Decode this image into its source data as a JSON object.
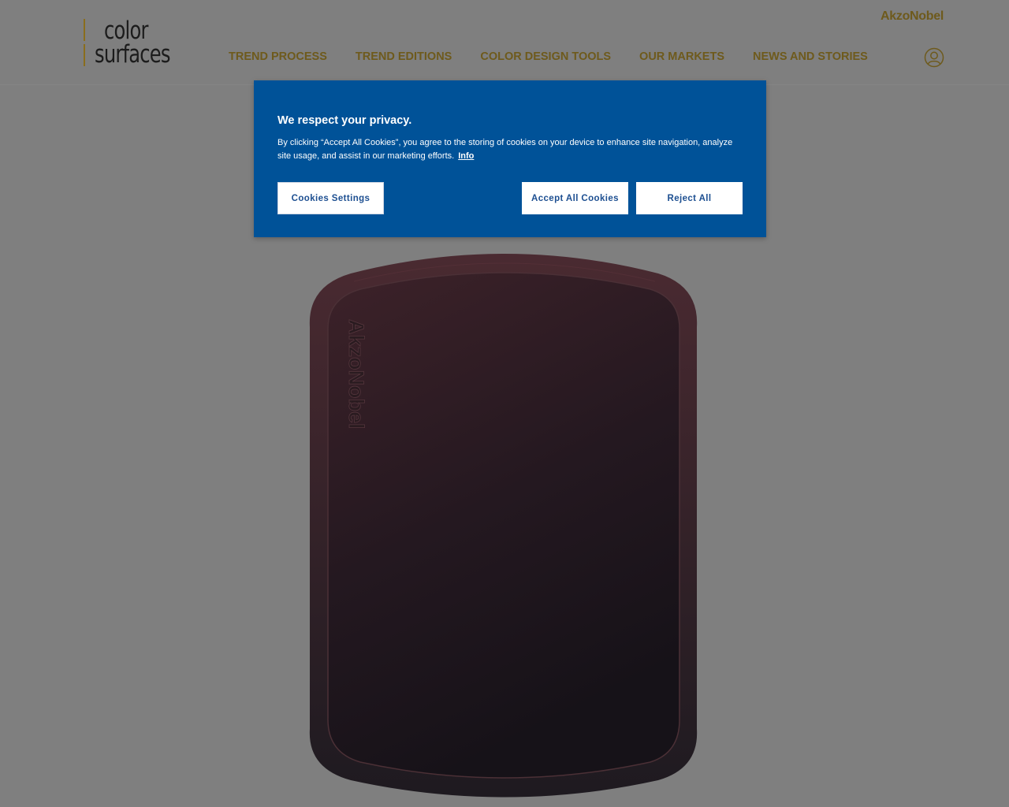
{
  "header": {
    "logo": {
      "line1": "color",
      "line2": "surfaces"
    },
    "brand": "AkzoNobel",
    "nav": [
      {
        "label": "TREND PROCESS"
      },
      {
        "label": "TREND EDITIONS"
      },
      {
        "label": "COLOR DESIGN TOOLS"
      },
      {
        "label": "OUR MARKETS"
      },
      {
        "label": "NEWS AND STORIES"
      }
    ],
    "user_icon": "user-account-icon"
  },
  "product": {
    "embossed_text": "AkzoNobel",
    "colors": {
      "panel_top": "#3a2128",
      "panel_bottom": "#18131a"
    }
  },
  "cookie_banner": {
    "title": "We respect your privacy.",
    "body": "By clicking “Accept All Cookies”, you agree to the storing of cookies on your device to enhance site navigation, analyze site usage, and assist in our marketing efforts.",
    "info_link": "Info",
    "buttons": {
      "settings": "Cookies Settings",
      "accept": "Accept All Cookies",
      "reject": "Reject All"
    },
    "colors": {
      "background": "#005298",
      "button_text": "#1d4f91"
    }
  },
  "colors": {
    "accent": "#6e5a1c",
    "overlay": "#7f7f7f"
  }
}
